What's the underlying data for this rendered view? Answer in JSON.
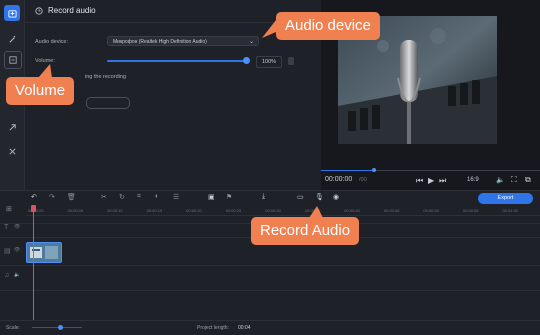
{
  "panel": {
    "title": "Record audio",
    "audio_device_label": "Audio device:",
    "audio_device_value": "Микрофон (Realtek High Definition Audio)",
    "volume_label": "Volume:",
    "volume_value": "100%",
    "volume_level": 1.0,
    "recording_hint": "ing the recording"
  },
  "callouts": {
    "audio_device": "Audio device",
    "volume": "Volume",
    "record_audio": "Record Audio"
  },
  "player": {
    "timecode": "00:00:00",
    "timecode_total": "/00",
    "aspect_ratio": "16:9",
    "progress": 0.24
  },
  "timeline": {
    "export_label": "Export",
    "ruler_ticks": [
      "00:00:00",
      "00:00:05",
      "00:00:10",
      "00:00:15",
      "00:00:20",
      "00:00:25",
      "00:00:30",
      "00:00:35",
      "00:00:40",
      "00:00:45",
      "00:00:50",
      "00:00:55",
      "00:01:00"
    ],
    "project_length_label": "Project length:",
    "project_length_value": "00:04",
    "scale_label": "Scale:"
  },
  "colors": {
    "accent": "#2f74e8",
    "callout": "#f08050",
    "playhead": "#e0505c"
  }
}
